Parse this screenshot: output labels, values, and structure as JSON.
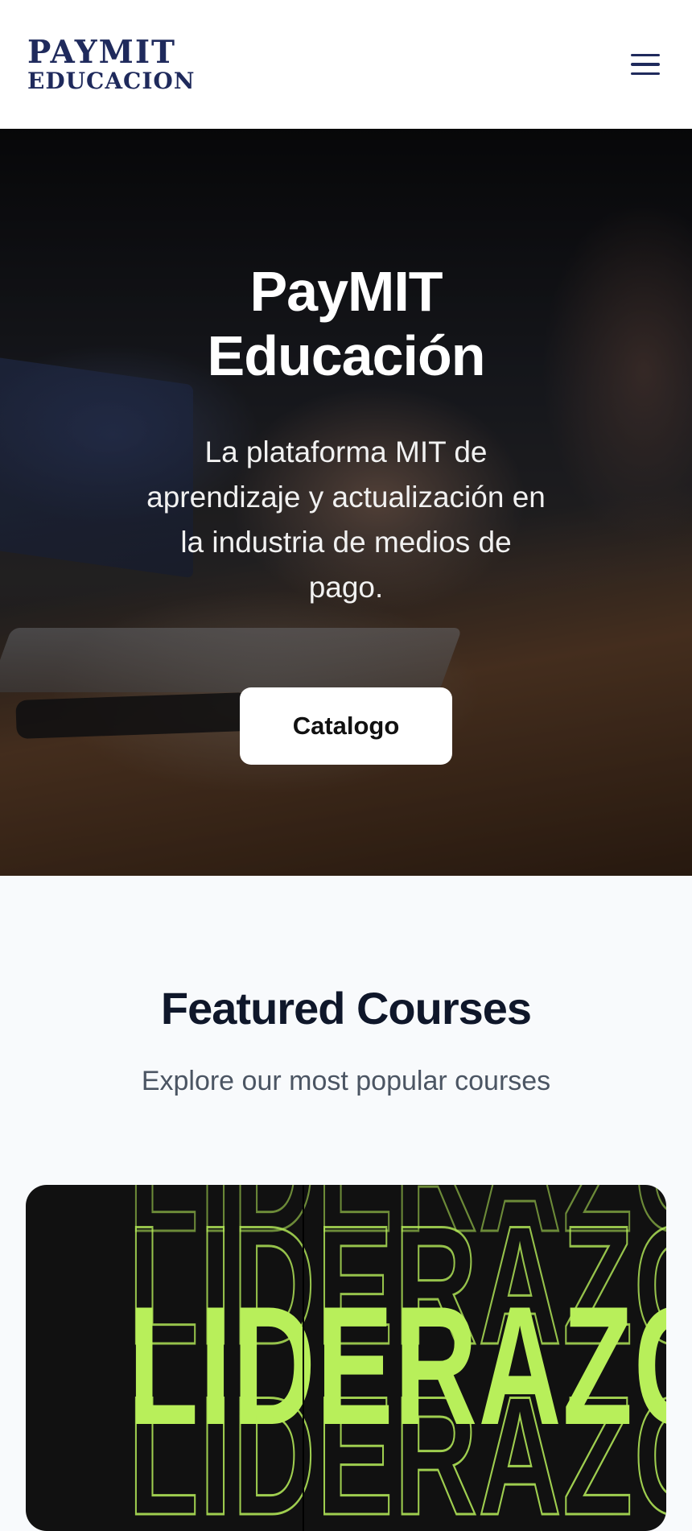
{
  "header": {
    "logo_line1": "PAYMIT",
    "logo_line2": "EDUCACION",
    "menu_icon": "hamburger-menu-icon",
    "brand_color": "#1f2a5c"
  },
  "hero": {
    "title": "PayMIT Educación",
    "subtitle": "La plataforma MIT de aprendizaje y actualización en la industria de medios de pago.",
    "cta_label": "Catalogo"
  },
  "featured": {
    "title": "Featured Courses",
    "subtitle": "Explore our most popular courses",
    "courses": [
      {
        "image_text": "LIDERAZGO",
        "accent_color": "#b8ef5a"
      }
    ]
  }
}
